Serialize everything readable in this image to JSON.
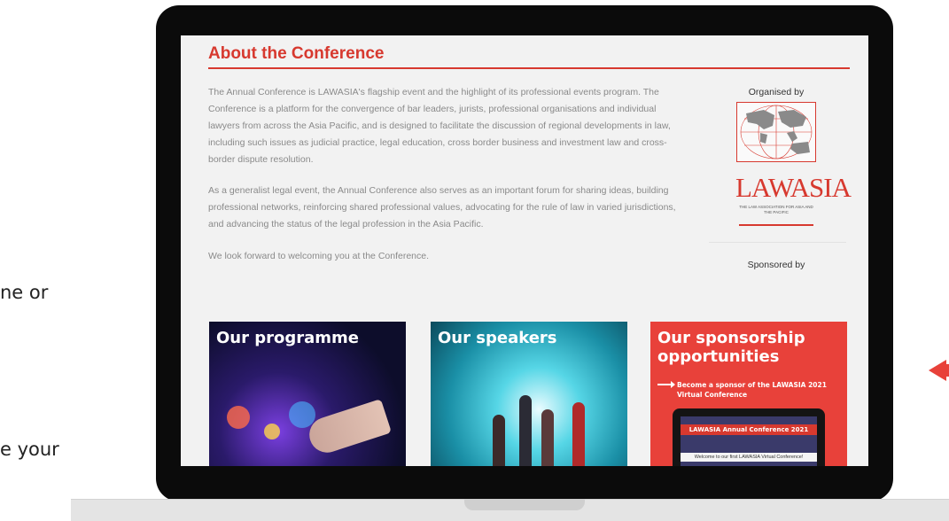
{
  "side_text": {
    "line1": "ne or",
    "line2": "e your"
  },
  "page": {
    "title": "About the Conference",
    "paragraphs": [
      "The Annual Conference is LAWASIA's flagship event and the highlight of its professional events program. The Conference is a platform for the convergence of bar leaders, jurists, professional organisations and individual lawyers from across the Asia Pacific, and is designed to facilitate the discussion of regional developments in law, including such issues as judicial practice, legal education, cross border business and investment law and cross-border dispute resolution.",
      "As a generalist legal event, the Annual Conference also serves as an important forum for sharing ideas, building professional networks, reinforcing shared professional values, advocating for the rule of law in varied jurisdictions, and advancing the status of the legal profession in the Asia Pacific.",
      "We look forward to welcoming you at the Conference."
    ]
  },
  "sidebar": {
    "organised_by": "Organised by",
    "logo_text": "LAWASIA",
    "logo_sub": "THE LAW ASSOCIATION FOR ASIA AND THE PACIFIC",
    "sponsored_by": "Sponsored by"
  },
  "cards": {
    "programme": {
      "title": "Our programme"
    },
    "speakers": {
      "title": "Our speakers"
    },
    "sponsorship": {
      "title": "Our sponsorship opportunities",
      "subtitle": "Become a sponsor of the LAWASIA 2021 Virtual Conference",
      "banner": "LAWASIA Annual Conference 2021",
      "welcome": "Welcome to our first LAWASIA Virtual Conference!"
    }
  },
  "colors": {
    "accent": "#d7392f",
    "sponsorship_card": "#e8413a",
    "laptop_frame": "#0b0b0b",
    "screen_bg": "#f2f2f2"
  },
  "icons": [
    "arrow-left-icon",
    "arrow-right-icon",
    "world-map-icon"
  ]
}
